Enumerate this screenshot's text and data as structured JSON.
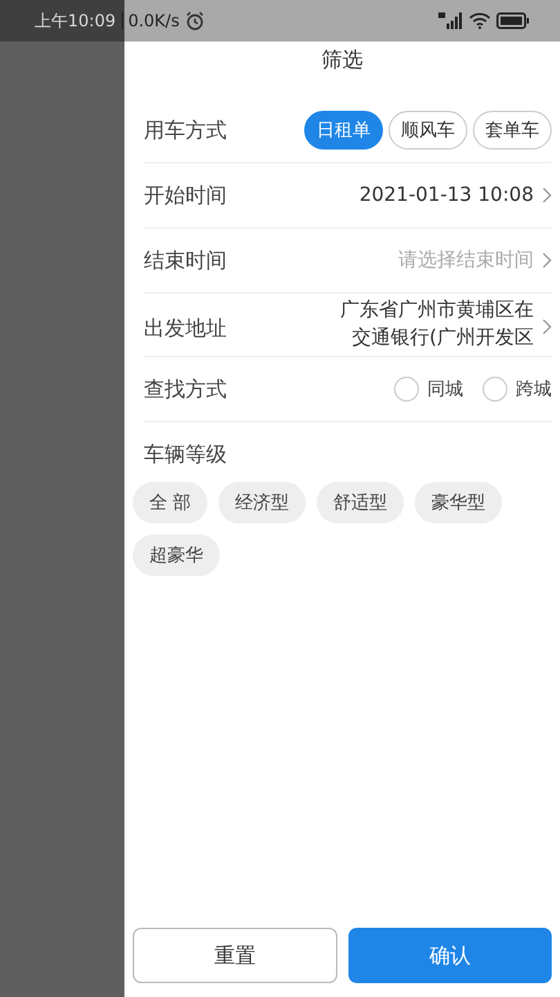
{
  "status_bar": {
    "time": "上午10:09",
    "speed": "0.0K/s"
  },
  "title": "筛选",
  "mode": {
    "label": "用车方式",
    "options": [
      {
        "label": "日租单",
        "selected": true
      },
      {
        "label": "顺风车",
        "selected": false
      },
      {
        "label": "套单车",
        "selected": false
      }
    ]
  },
  "rows": [
    {
      "label": "开始时间",
      "value": "2021-01-13 10:08",
      "placeholder": false
    },
    {
      "label": "结束时间",
      "value": "请选择结束时间",
      "placeholder": true
    }
  ],
  "address": {
    "label": "出发地址",
    "lines": [
      "广东省广州市黄埔区在",
      "交通银行(广州开发区"
    ]
  },
  "search_mode": {
    "label": "查找方式",
    "options": [
      {
        "label": "同城",
        "selected": false
      },
      {
        "label": "跨城",
        "selected": false
      }
    ]
  },
  "grade": {
    "label": "车辆等级",
    "options": [
      {
        "label": "全 部",
        "selected": false
      },
      {
        "label": "经济型",
        "selected": false
      },
      {
        "label": "舒适型",
        "selected": false
      },
      {
        "label": "豪华型",
        "selected": false
      },
      {
        "label": "超豪华",
        "selected": false
      }
    ]
  },
  "buttons": {
    "reset": "重置",
    "confirm": "确认"
  }
}
